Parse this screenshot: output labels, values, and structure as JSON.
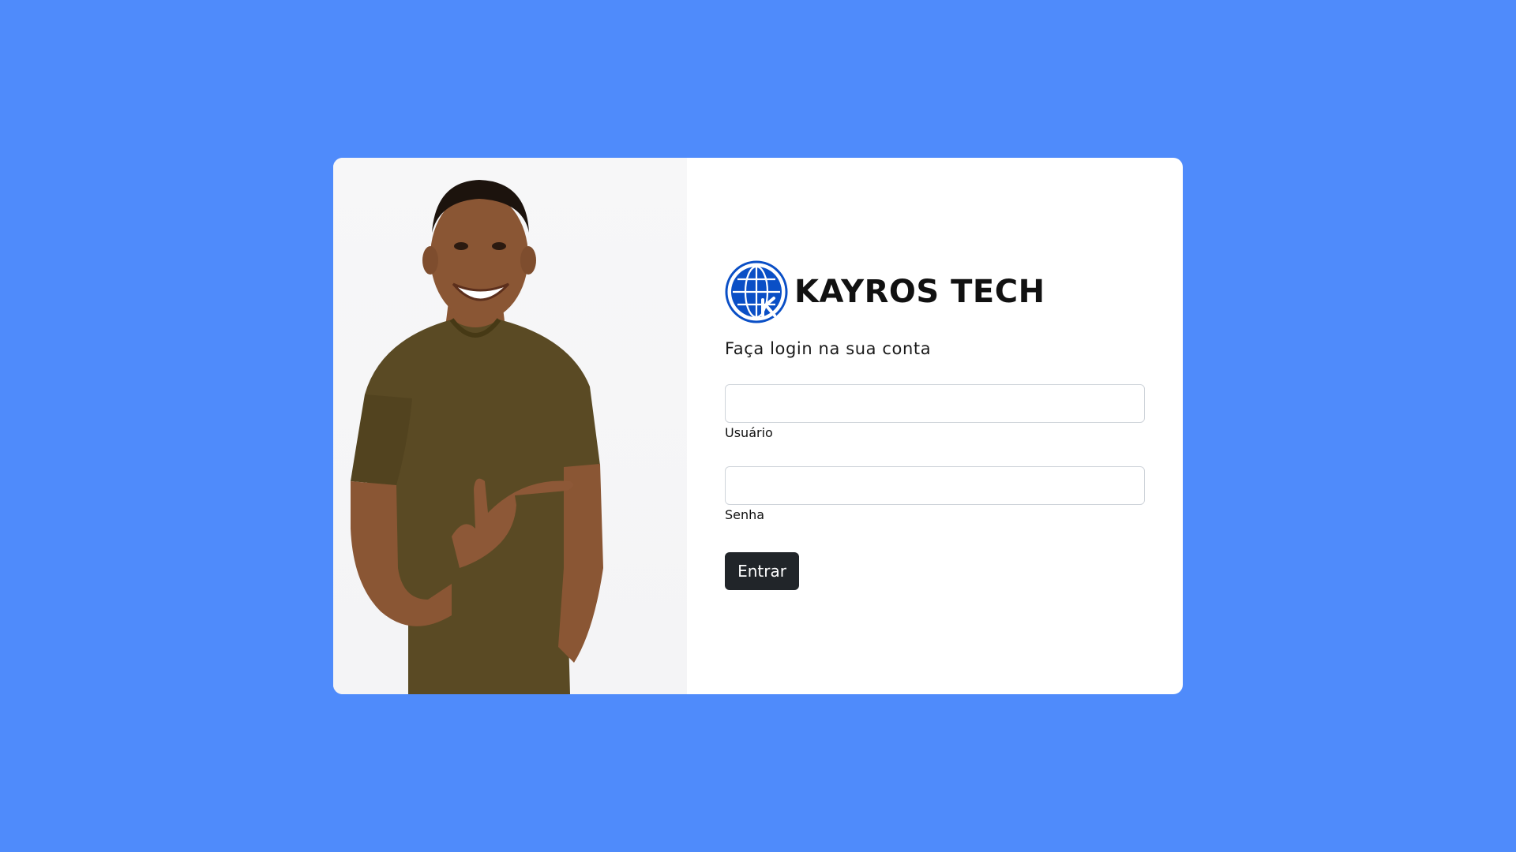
{
  "brand": {
    "name": "KAYROS TECH",
    "logo_icon": "globe-k-logo",
    "logo_color": "#0a4fc6"
  },
  "login": {
    "subtitle": "Faça login na sua conta",
    "username_label": "Usuário",
    "username_value": "",
    "password_label": "Senha",
    "password_value": "",
    "submit_label": "Entrar"
  },
  "colors": {
    "background": "#4f8bfb",
    "card": "#ffffff",
    "button": "#212529",
    "shirt": "#5a4a24"
  },
  "photo": {
    "subject": "smiling-man-pointing"
  }
}
